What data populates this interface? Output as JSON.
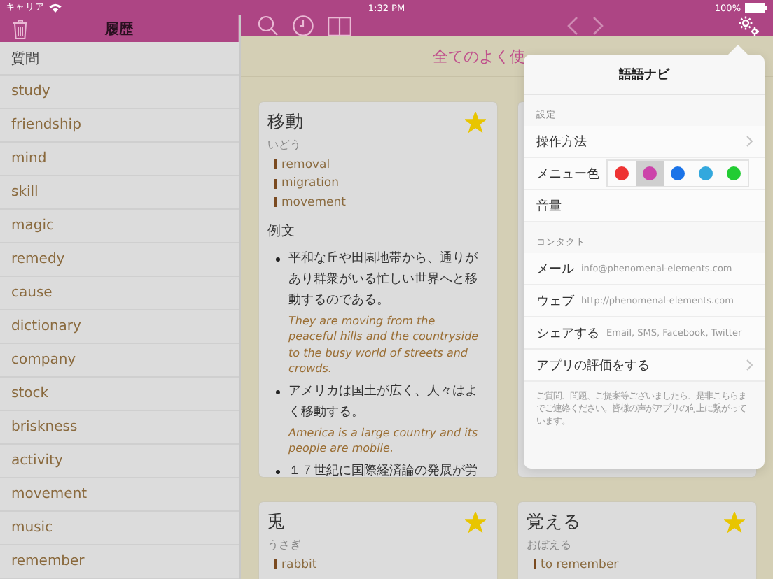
{
  "status_bar": {
    "carrier": "キャリア",
    "time": "1:32 PM",
    "battery": "100%"
  },
  "sidebar": {
    "title": "履歴",
    "items": [
      {
        "label": "質問",
        "kind": "ja"
      },
      {
        "label": "study",
        "kind": "en"
      },
      {
        "label": "friendship",
        "kind": "en"
      },
      {
        "label": "mind",
        "kind": "en"
      },
      {
        "label": "skill",
        "kind": "en"
      },
      {
        "label": "magic",
        "kind": "en"
      },
      {
        "label": "remedy",
        "kind": "en"
      },
      {
        "label": "cause",
        "kind": "en"
      },
      {
        "label": "dictionary",
        "kind": "en"
      },
      {
        "label": "company",
        "kind": "en"
      },
      {
        "label": "stock",
        "kind": "en"
      },
      {
        "label": "briskness",
        "kind": "en"
      },
      {
        "label": "activity",
        "kind": "en"
      },
      {
        "label": "movement",
        "kind": "en"
      },
      {
        "label": "music",
        "kind": "en"
      },
      {
        "label": "remember",
        "kind": "en"
      }
    ]
  },
  "toolbar": {
    "back": {
      "disabled": true
    },
    "forward": {
      "disabled": true
    }
  },
  "main": {
    "title": "全てのよく使",
    "cards": [
      {
        "word": "移動",
        "reading": "いどう",
        "starred": true,
        "meanings": [
          "removal",
          "migration",
          "movement"
        ],
        "examples_heading": "例文",
        "examples": [
          {
            "ja": "平和な丘や田園地帯から、通りがあり群衆がいる忙しい世界へと移動するのである。",
            "en": "They are moving from the peaceful hills and the countryside to the busy world of streets and crowds."
          },
          {
            "ja": "アメリカは国土が広く、人々はよく移動する。",
            "en": "America is a large country and its people are mobile."
          },
          {
            "ja": "１７世紀に国際経済論の発展が労"
          }
        ]
      },
      {
        "word": "兎",
        "reading": "うさぎ",
        "starred": true,
        "meanings": [
          "rabbit"
        ]
      },
      {
        "word": "覚える",
        "reading": "おぼえる",
        "starred": true,
        "meanings": [
          "to remember"
        ]
      }
    ]
  },
  "popover": {
    "title": "語語ナビ",
    "sections": [
      {
        "label": "設定",
        "rows": [
          {
            "kind": "link",
            "label": "操作方法"
          },
          {
            "kind": "colors",
            "label": "メニュー色",
            "swatches": [
              {
                "color": "#ee3333",
                "selected": false
              },
              {
                "color": "#cc44aa",
                "selected": true
              },
              {
                "color": "#1a73e8",
                "selected": false
              },
              {
                "color": "#33a8dd",
                "selected": false
              },
              {
                "color": "#22cc33",
                "selected": false
              }
            ]
          },
          {
            "kind": "plain",
            "label": "音量"
          }
        ]
      },
      {
        "label": "コンタクト",
        "rows": [
          {
            "kind": "value",
            "label": "メール",
            "value": "info@phenomenal-elements.com"
          },
          {
            "kind": "value",
            "label": "ウェブ",
            "value": "http://phenomenal-elements.com"
          },
          {
            "kind": "value",
            "label": "シェアする",
            "value": "Email, SMS, Facebook, Twitter"
          },
          {
            "kind": "link",
            "label": "アプリの評価をする"
          }
        ]
      }
    ],
    "footer": "ご質問、問題、ご提案等ございましたら、是非こちらまでご連絡ください。皆様の声がアプリの向上に繋がっています。"
  }
}
